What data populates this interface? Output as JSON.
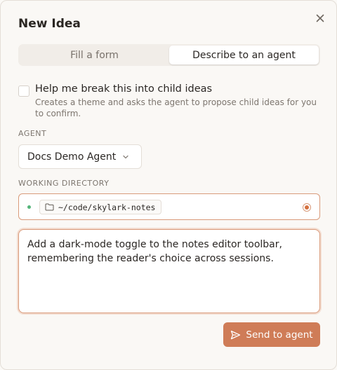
{
  "dialog": {
    "title": "New Idea",
    "close_icon": "close-icon"
  },
  "tabs": [
    {
      "label": "Fill a form",
      "active": false
    },
    {
      "label": "Describe to an agent",
      "active": true
    }
  ],
  "breakdown": {
    "label": "Help me break this into child ideas",
    "description": "Creates a theme and asks the agent to propose child ideas for you to confirm.",
    "checked": false
  },
  "agent": {
    "section_label": "AGENT",
    "selected": "Docs Demo Agent",
    "icon": "chevron-down-icon"
  },
  "working_directory": {
    "section_label": "WORKING DIRECTORY",
    "path": "~/code/skylark-notes",
    "status_color": "#55b57a",
    "icon": "folder-icon"
  },
  "prompt": {
    "value": "Add a dark-mode toggle to the notes editor toolbar, remembering the reader's choice across sessions."
  },
  "actions": {
    "send_label": "Send to agent",
    "send_icon": "send-icon"
  },
  "colors": {
    "accent": "#cf7c57",
    "accent_border": "#d99a7a",
    "background": "#faf8f5"
  }
}
